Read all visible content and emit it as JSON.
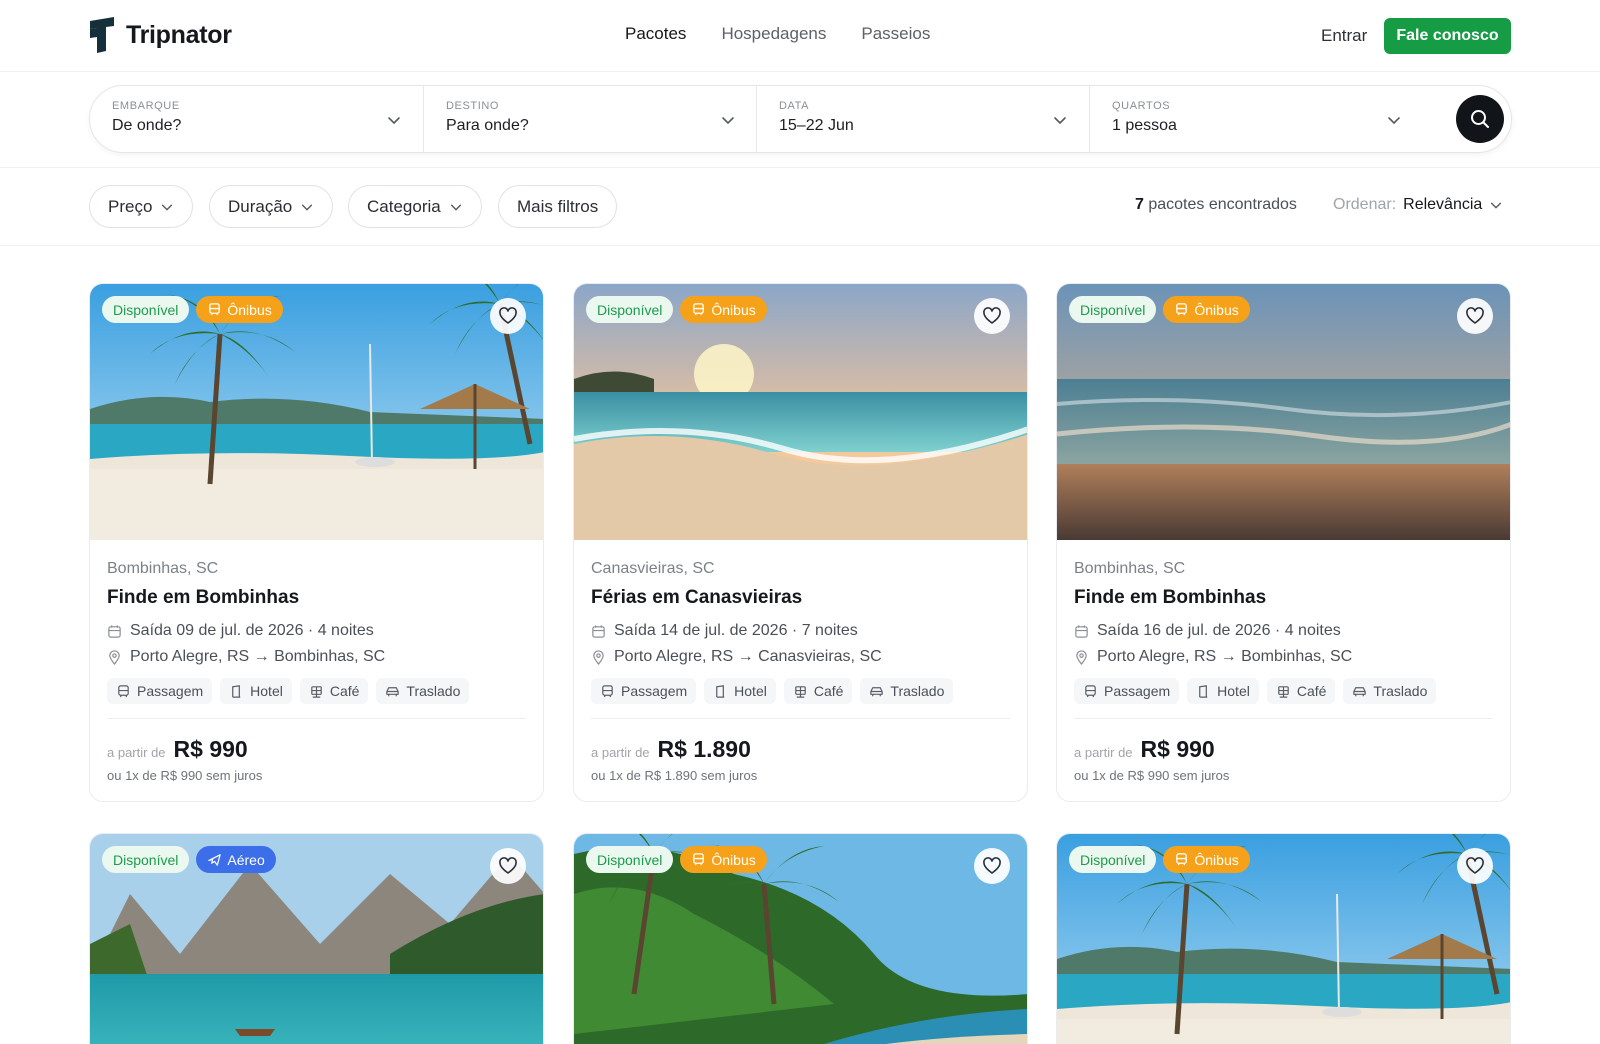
{
  "brand": {
    "name": "Tripnator"
  },
  "nav": {
    "items": [
      "Pacotes",
      "Hospedagens",
      "Passeios"
    ],
    "active": "Pacotes"
  },
  "header": {
    "login": "Entrar",
    "cta": "Fale conosco"
  },
  "search": {
    "fields": [
      {
        "label": "EMBARQUE",
        "value": "De onde?"
      },
      {
        "label": "DESTINO",
        "value": "Para onde?"
      },
      {
        "label": "DATA",
        "value": "15–22 Jun"
      },
      {
        "label": "QUARTOS",
        "value": "1 pessoa"
      }
    ]
  },
  "filters": {
    "chips": [
      "Preço",
      "Duração",
      "Categoria",
      "Mais filtros"
    ],
    "results_count": "7",
    "results_text": "pacotes encontrados",
    "sort_label": "Ordenar:",
    "sort_value": "Relevância"
  },
  "colors": {
    "brand_green": "#169c45",
    "bus_orange": "#f5a21a",
    "air_blue": "#3b6ee8"
  },
  "cards": [
    {
      "availability": "Disponível",
      "transport": "Ônibus",
      "transport_icon": "bus-icon",
      "scene": "beach-palm",
      "location": "Bombinhas, SC",
      "title": "Finde em Bombinhas",
      "departure": "Saída 09 de jul. de 2026 · 4 noites",
      "route": "Porto Alegre, RS → Bombinhas, SC",
      "tags": [
        "Passagem",
        "Hotel",
        "Café",
        "Traslado"
      ],
      "price_from": "a partir de",
      "price": "R$ 990",
      "installments": "ou 1x de R$ 990 sem juros"
    },
    {
      "availability": "Disponível",
      "transport": "Ônibus",
      "transport_icon": "bus-icon",
      "scene": "sunset-waves",
      "location": "Canasvieiras, SC",
      "title": "Férias em Canasvieiras",
      "departure": "Saída 14 de jul. de 2026 · 7 noites",
      "route": "Porto Alegre, RS → Canasvieiras, SC",
      "tags": [
        "Passagem",
        "Hotel",
        "Café",
        "Traslado"
      ],
      "price_from": "a partir de",
      "price": "R$ 1.890",
      "installments": "ou 1x de R$ 1.890 sem juros"
    },
    {
      "availability": "Disponível",
      "transport": "Ônibus",
      "transport_icon": "bus-icon",
      "scene": "sunset-sea",
      "location": "Bombinhas, SC",
      "title": "Finde em Bombinhas",
      "departure": "Saída 16 de jul. de 2026 · 4 noites",
      "route": "Porto Alegre, RS → Bombinhas, SC",
      "tags": [
        "Passagem",
        "Hotel",
        "Café",
        "Traslado"
      ],
      "price_from": "a partir de",
      "price": "R$ 990",
      "installments": "ou 1x de R$ 990 sem juros"
    },
    {
      "availability": "Disponível",
      "transport": "Aéreo",
      "transport_icon": "plane-icon",
      "scene": "mountain-lake"
    },
    {
      "availability": "Disponível",
      "transport": "Ônibus",
      "transport_icon": "bus-icon",
      "scene": "tropical-forest"
    },
    {
      "availability": "Disponível",
      "transport": "Ônibus",
      "transport_icon": "bus-icon",
      "scene": "beach-palm"
    }
  ],
  "tag_icons": [
    "ticket-icon",
    "hotel-icon",
    "coffee-icon",
    "car-icon"
  ]
}
